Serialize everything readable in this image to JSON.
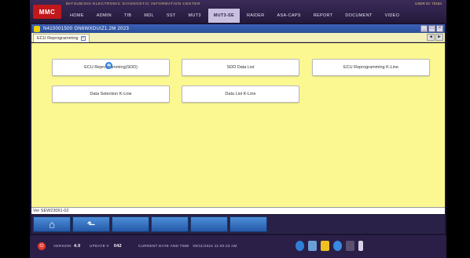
{
  "header": {
    "logo": "MMC",
    "brand_line": "MITSUBISHI ELECTRONIC DIAGNOSTIC INFORMATION CENTER",
    "user_line": "USER ID: 70184",
    "menu": [
      "HOME",
      "ADMIN",
      "TIB",
      "MDL",
      "SST",
      "MUT3",
      "MUT3-SE",
      "RAIDER",
      "ASA-CAPS",
      "REPORT",
      "DOCUMENT",
      "VIDEO"
    ],
    "active_menu": "MUT3-SE"
  },
  "window": {
    "title": "N410001500 GN6WXDUIZ1.2M 2023",
    "controls": [
      "_",
      "□",
      "×"
    ]
  },
  "tabs": {
    "active_tab": "ECU Reprogramming",
    "close_glyph": "×",
    "prev": "◀",
    "next": "▶"
  },
  "buttons": {
    "ecu_reprogramming_sd": "ECU Reprogramming(SDD)",
    "sdd_data_list": "SDD Data List",
    "ecu_reprogramming_kline": "ECU Reprogramming K-Line",
    "data_selection_kline": "Data Selection K-Line",
    "data_list_kline": "Data List K-Line"
  },
  "version_text": "Ver SEW23061-02",
  "bottom_nav": {
    "home_glyph": "⌂",
    "back_glyph": "⬑"
  },
  "status": {
    "version_label": "VERSION",
    "version_value": "4.0",
    "update_label": "UPDATE #",
    "update_value": "042",
    "datetime_label": "CURRENT DATE AND TIME",
    "datetime_value": "09/11/2024 11:00:23 AM"
  },
  "colors": {
    "workarea": "#fbf892",
    "titlebar": "#2a4d9a",
    "power": "#e63b2e",
    "brand_red": "#c0181c"
  }
}
